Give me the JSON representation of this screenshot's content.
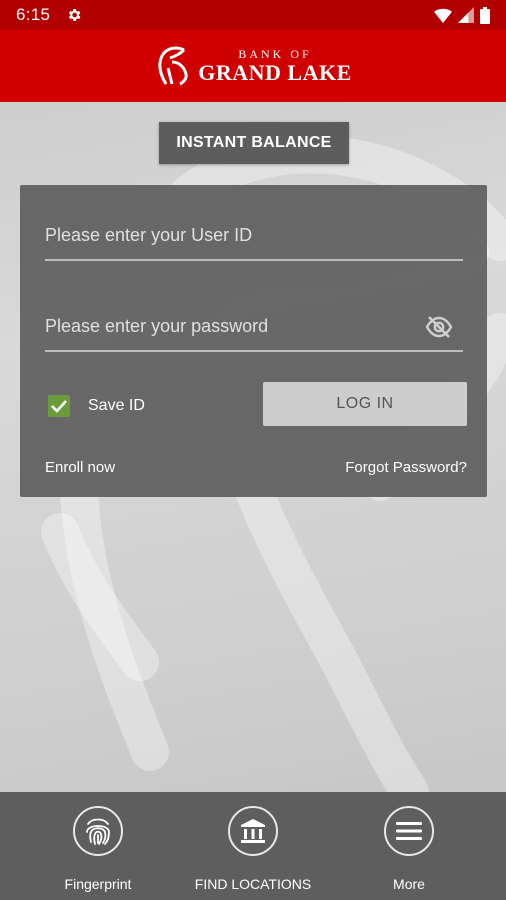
{
  "status_bar": {
    "time": "6:15",
    "icons": [
      "settings-icon",
      "wifi-icon",
      "signal-icon",
      "battery-icon"
    ]
  },
  "header": {
    "brand_top": "BANK OF",
    "brand_main": "GRAND LAKE"
  },
  "instant_balance_label": "INSTANT BALANCE",
  "login": {
    "user_placeholder": "Please enter your User ID",
    "password_placeholder": "Please enter your password",
    "save_id_label": "Save ID",
    "save_id_checked": true,
    "login_label": "LOG IN",
    "enroll_label": "Enroll now",
    "forgot_label": "Forgot Password?"
  },
  "bottom_nav": {
    "fingerprint_label": "Fingerprint",
    "locations_label": "FIND LOCATIONS",
    "more_label": "More"
  },
  "colors": {
    "status_bar": "#b20000",
    "header": "#d10000",
    "panel": "#5f5f5f",
    "checkbox": "#6b9b3a",
    "bottom_bar": "#5e5e5e"
  }
}
